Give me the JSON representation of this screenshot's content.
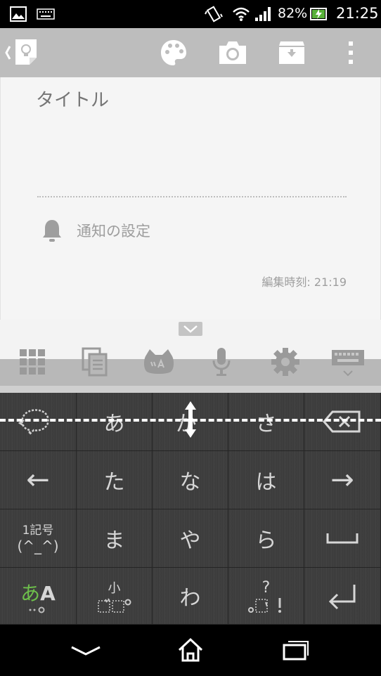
{
  "status_bar": {
    "battery_percent": "82%",
    "time": "21:25"
  },
  "note": {
    "title_placeholder": "タイトル",
    "reminder_label": "通知の設定",
    "edited_time": "編集時刻: 21:19"
  },
  "keyboard": {
    "rows": [
      [
        "",
        "あ",
        "か",
        "さ",
        ""
      ],
      [
        "←",
        "た",
        "な",
        "は",
        "→"
      ],
      [
        "",
        "ま",
        "や",
        "ら",
        ""
      ],
      [
        "",
        "",
        "わ",
        "",
        ""
      ]
    ],
    "symbol_key_top": "1記号",
    "symbol_key_bottom": "(^_^)",
    "mode_key_kana": "あ",
    "mode_key_latin": "A",
    "small_key_label": "小",
    "punct_key_label": "?"
  },
  "colors": {
    "action_bar": "#bdbdbd",
    "note_bg": "#f5f5f5",
    "keyboard_bg": "#3a3a3a",
    "key_text": "#d6d6d6",
    "mode_kana": "#6dbf4b"
  }
}
